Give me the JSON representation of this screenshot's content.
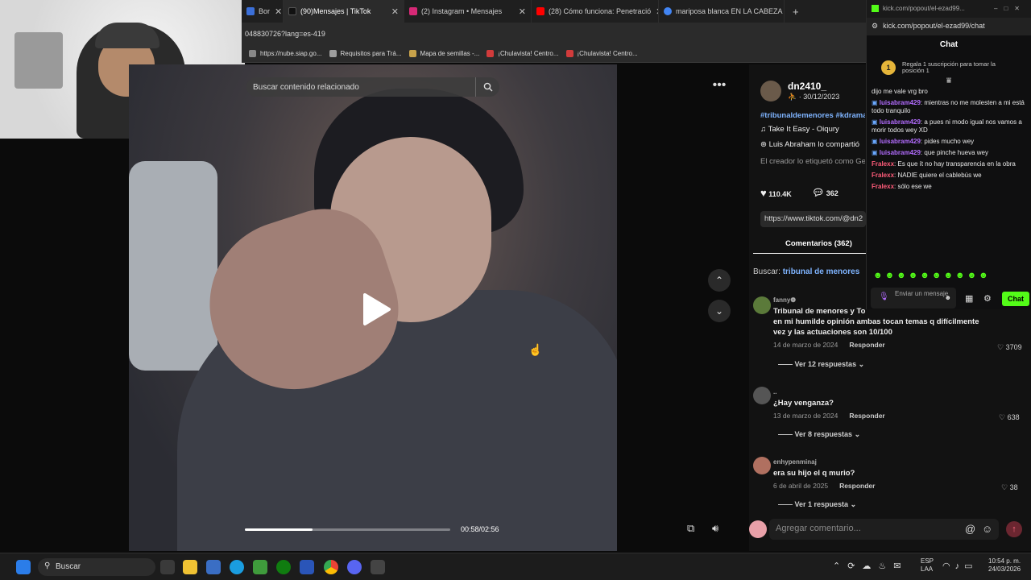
{
  "browser": {
    "tabs": [
      {
        "label": "Bor",
        "color": "#3b6fd8"
      },
      {
        "label": "(90)Mensajes | TikTok",
        "color": "#111111",
        "active": true
      },
      {
        "label": "(2) Instagram • Mensajes",
        "color": "#d62976"
      },
      {
        "label": "(28) Cómo funciona: Penetració",
        "color": "#ff0000"
      },
      {
        "label": "mariposa blanca EN LA CABEZA",
        "color": "#4285f4"
      }
    ],
    "new_tab": "+",
    "address_fragment": "04883072​6?lang=es-419",
    "bookmarks": [
      {
        "label": "https://nube.siap.go...",
        "color": "#888888"
      },
      {
        "label": "Requisitos para Trá...",
        "color": "#9e9e9e"
      },
      {
        "label": "Mapa de semillas -...",
        "color": "#c8a24a"
      },
      {
        "label": "¡Chulavista! Centro...",
        "color": "#d13b3b"
      },
      {
        "label": "¡Chulavista! Centro...",
        "color": "#d13b3b"
      }
    ]
  },
  "video": {
    "search_placeholder": "Buscar contenido relacionado",
    "time": "00:58/02:56",
    "progress": 0.33
  },
  "post": {
    "username": "dn2410_",
    "date": "· 30/12/2023",
    "hashtags": "#tribunaldemenores #kdrama",
    "music": "Take It Easy - Oiqury",
    "shared": "Luis Abraham lo compartió",
    "tagged": "El creador lo etiquetó como Ge",
    "likes": "110.4K",
    "comments_count": "362",
    "link": "https://www.tiktok.com/@dn2",
    "comments_tab": "Comentarios (362)",
    "search_label": "Buscar:",
    "search_term": "tribunal de menores",
    "add_comment_placeholder": "Agregar comentario..."
  },
  "comments": [
    {
      "user": "fanny❁",
      "text": "Tribunal de menores y To... en mi humilde opinión ambas tocan temas q difícilmente vez y las actuaciones son 10/100",
      "text_lines": [
        "Tribunal de menores y To",
        "en mi humilde opinión ambas tocan temas q difícilmente",
        "vez y las actuaciones son 10/100"
      ],
      "date": "14 de marzo de 2024",
      "reply": "Responder",
      "likes": "3709",
      "more": "Ver 12 respuestas",
      "avatar_color": "#5b7a3a"
    },
    {
      "user": "..",
      "text_lines": [
        "¿Hay venganza?"
      ],
      "date": "13 de marzo de 2024",
      "reply": "Responder",
      "likes": "638",
      "more": "Ver 8 respuestas",
      "avatar_color": "#555555"
    },
    {
      "user": "enhypenminaj",
      "text_lines": [
        "era su hijo el q murio?"
      ],
      "date": "6 de abril de 2025",
      "reply": "Responder",
      "likes": "38",
      "more": "Ver 1 respuesta",
      "avatar_color": "#b07060"
    }
  ],
  "chat": {
    "url": "kick.com/popout/el-ezad99/chat",
    "url_short": "kick.com/popout/el-ezad99...",
    "title": "Chat",
    "pinned_rank": "1",
    "pinned_text": "Regala 1 suscripción para tomar la posición 1",
    "messages": [
      {
        "user": "",
        "text": "dijo me vale vrg bro",
        "color": "#e8e8e8"
      },
      {
        "user": "luisabram429",
        "text": "mientras no me molesten a mi está todo tranquilo",
        "color": "#b36cff"
      },
      {
        "user": "luisabram429",
        "text": "a pues ni modo igual nos vamos a morir todos wey XD",
        "color": "#b36cff"
      },
      {
        "user": "luisabram429",
        "text": "pides mucho wey",
        "color": "#b36cff"
      },
      {
        "user": "luisabram429",
        "text": "que pinche hueva wey",
        "color": "#b36cff"
      },
      {
        "user": "Fralexx",
        "text": "Es que ít no hay transparencia en la obra",
        "color": "#ff5c7a"
      },
      {
        "user": "Fralexx",
        "text": "NADIE quiere el cablebús we",
        "color": "#ff5c7a"
      },
      {
        "user": "Fralexx",
        "text": "sólo ese we",
        "color": "#ff5c7a"
      }
    ],
    "input_placeholder": "Enviar un mensaje",
    "send_label": "Chat",
    "accent": "#53fc18"
  },
  "taskbar": {
    "search": "Buscar",
    "lang": "ESP\nLAA",
    "lang1": "ESP",
    "lang2": "LAA",
    "time": "10:54 p. m.",
    "date": "24/03/2026"
  }
}
